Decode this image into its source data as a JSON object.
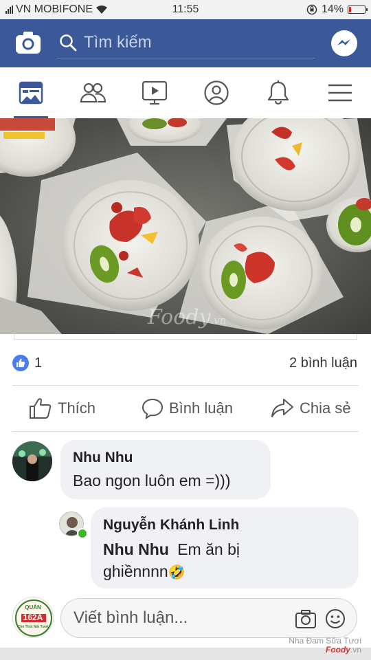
{
  "status_bar": {
    "carrier": "VN MOBIFONE",
    "time": "11:55",
    "battery_percent": "14%",
    "battery_level": 0.14,
    "battery_color": "#e02020"
  },
  "header": {
    "brand_color": "#3b5998",
    "camera_icon": "camera-icon",
    "search_placeholder": "Tìm kiếm",
    "messenger_icon": "messenger-icon"
  },
  "nav_tabs": [
    {
      "name": "news-feed",
      "icon": "newsfeed-icon",
      "active": true
    },
    {
      "name": "friends",
      "icon": "friends-icon"
    },
    {
      "name": "watch",
      "icon": "video-icon"
    },
    {
      "name": "profile",
      "icon": "profile-icon"
    },
    {
      "name": "notifications",
      "icon": "bell-icon"
    },
    {
      "name": "menu",
      "icon": "hamburger-menu-icon"
    }
  ],
  "post": {
    "photo_watermark": "Foody",
    "photo_watermark_suffix": ".vn",
    "like_count": "1",
    "comment_count": "2 bình luận",
    "actions": {
      "like": "Thích",
      "comment": "Bình luận",
      "share": "Chia sẻ"
    }
  },
  "comments": [
    {
      "author": "Nhu Nhu",
      "text": "Bao ngon luôn em =)))"
    },
    {
      "author": "Nguyễn Khánh Linh",
      "mention": "Nhu Nhu",
      "text_line1": "Em ăn bị",
      "text_line2": "ghiềnnnn",
      "emoji": "🤣"
    }
  ],
  "composer": {
    "placeholder": "Viết bình luận...",
    "avatar_text_top": "QUÁN",
    "avatar_text_mid": "162A",
    "avatar_text_bottom": "Chè Thốt Nốt Tươi"
  },
  "corner_watermark": {
    "line1": "Nha Đam Sữa Tươi",
    "line2": "Foody",
    "line2_suffix": ".vn"
  }
}
